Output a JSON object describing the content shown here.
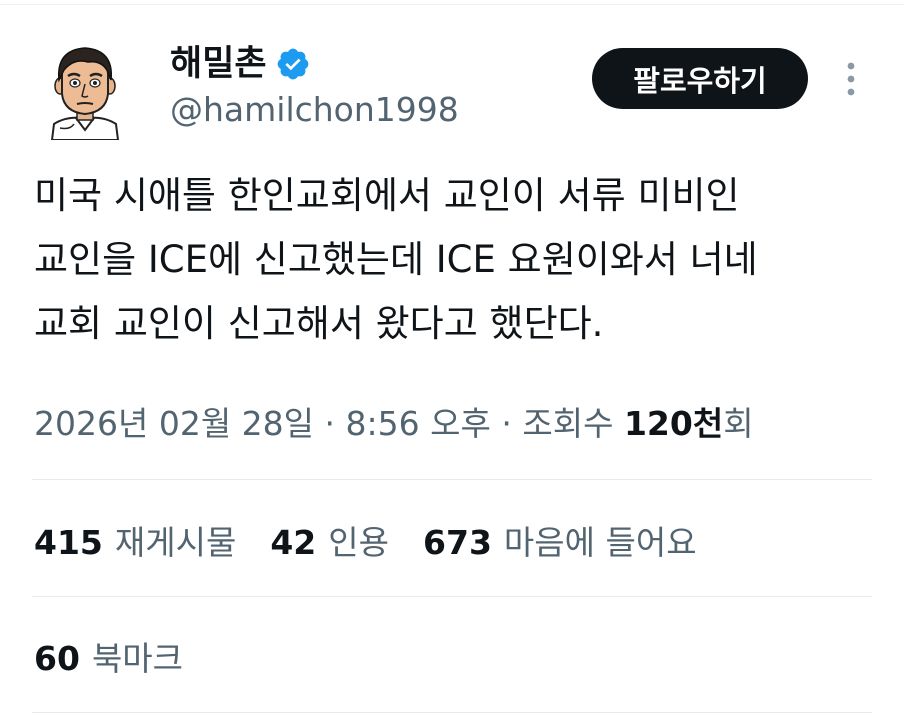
{
  "author": {
    "display_name": "해밀촌",
    "handle": "@hamilchon1998",
    "verified": true
  },
  "follow_button_label": "팔로우하기",
  "more_icon": "more-vertical-icon",
  "tweet": {
    "lines": [
      "미국 시애틀 한인교회에서 교인이 서류 미비인",
      "교인을 ICE에 신고했는데 ICE 요원이와서 너네",
      "교회 교인이 신고해서 왔다고 했단다."
    ]
  },
  "meta": {
    "date": "2026년 02월 28일",
    "time": "8:56 오후",
    "separator": "·",
    "views_prefix": "조회수",
    "views_value": "120천",
    "views_suffix": "회"
  },
  "stats": {
    "reposts": {
      "count": "415",
      "label": "재게시물"
    },
    "quotes": {
      "count": "42",
      "label": "인용"
    },
    "likes": {
      "count": "673",
      "label": "마음에 들어요"
    },
    "bookmarks": {
      "count": "60",
      "label": "북마크"
    }
  },
  "colors": {
    "text": "#0f1419",
    "secondary": "#536471",
    "verified_blue": "#1d9bf0",
    "button_bg": "#0f1419",
    "divider": "#e7ebed"
  }
}
